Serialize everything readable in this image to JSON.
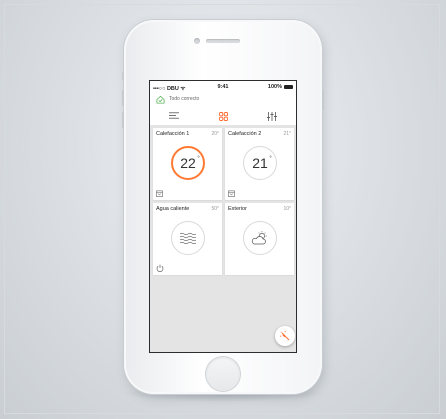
{
  "status_bar": {
    "carrier": "•••○○ DBU ᯤ",
    "time": "9:41",
    "battery": "100%"
  },
  "notice": {
    "icon": "home-check-icon",
    "text": "Todo correcto"
  },
  "tabs": [
    {
      "icon": "menu-lines-icon",
      "selected": false
    },
    {
      "icon": "grid-icon",
      "selected": true
    },
    {
      "icon": "sliders-icon",
      "selected": false
    }
  ],
  "cards": [
    {
      "title": "Calefacción 1",
      "temp": "20°",
      "dial_value": "22",
      "dial_unit": "°",
      "active": true,
      "corner_icon": "schedule-icon"
    },
    {
      "title": "Calefacción 2",
      "temp": "21°",
      "dial_value": "21",
      "dial_unit": "°",
      "active": false,
      "corner_icon": "schedule-icon"
    },
    {
      "title": "Agua caliente",
      "temp": "50°",
      "center_icon": "water-waves-icon",
      "corner_icon": "power-icon"
    },
    {
      "title": "Exterior",
      "temp": "10°",
      "center_icon": "partly-cloudy-icon"
    }
  ],
  "fab": {
    "icon": "magic-wand-icon"
  },
  "colors": {
    "accent": "#ff6a33",
    "card_bg": "#ffffff",
    "grid_bg": "#e4e4e4",
    "notice_icon": "#5bb35b"
  }
}
